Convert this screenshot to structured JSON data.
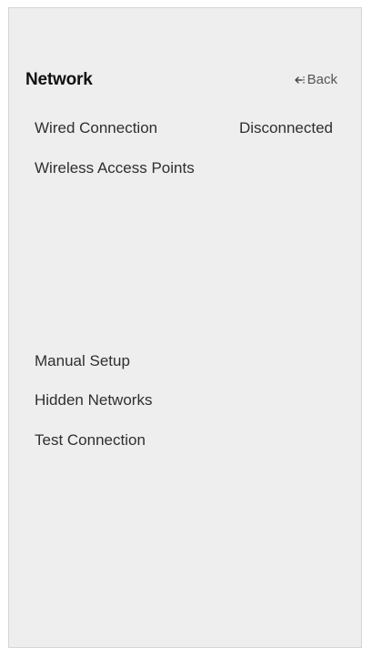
{
  "header": {
    "title": "Network",
    "back_label": "Back"
  },
  "menu": {
    "wired_connection": {
      "label": "Wired Connection",
      "status": "Disconnected"
    },
    "wireless_access_points": "Wireless Access Points",
    "manual_setup": "Manual Setup",
    "hidden_networks": "Hidden Networks",
    "test_connection": "Test Connection"
  },
  "colors": {
    "panel_background": "#eeeeee",
    "text": "#2f2f2f",
    "title": "#111111"
  }
}
